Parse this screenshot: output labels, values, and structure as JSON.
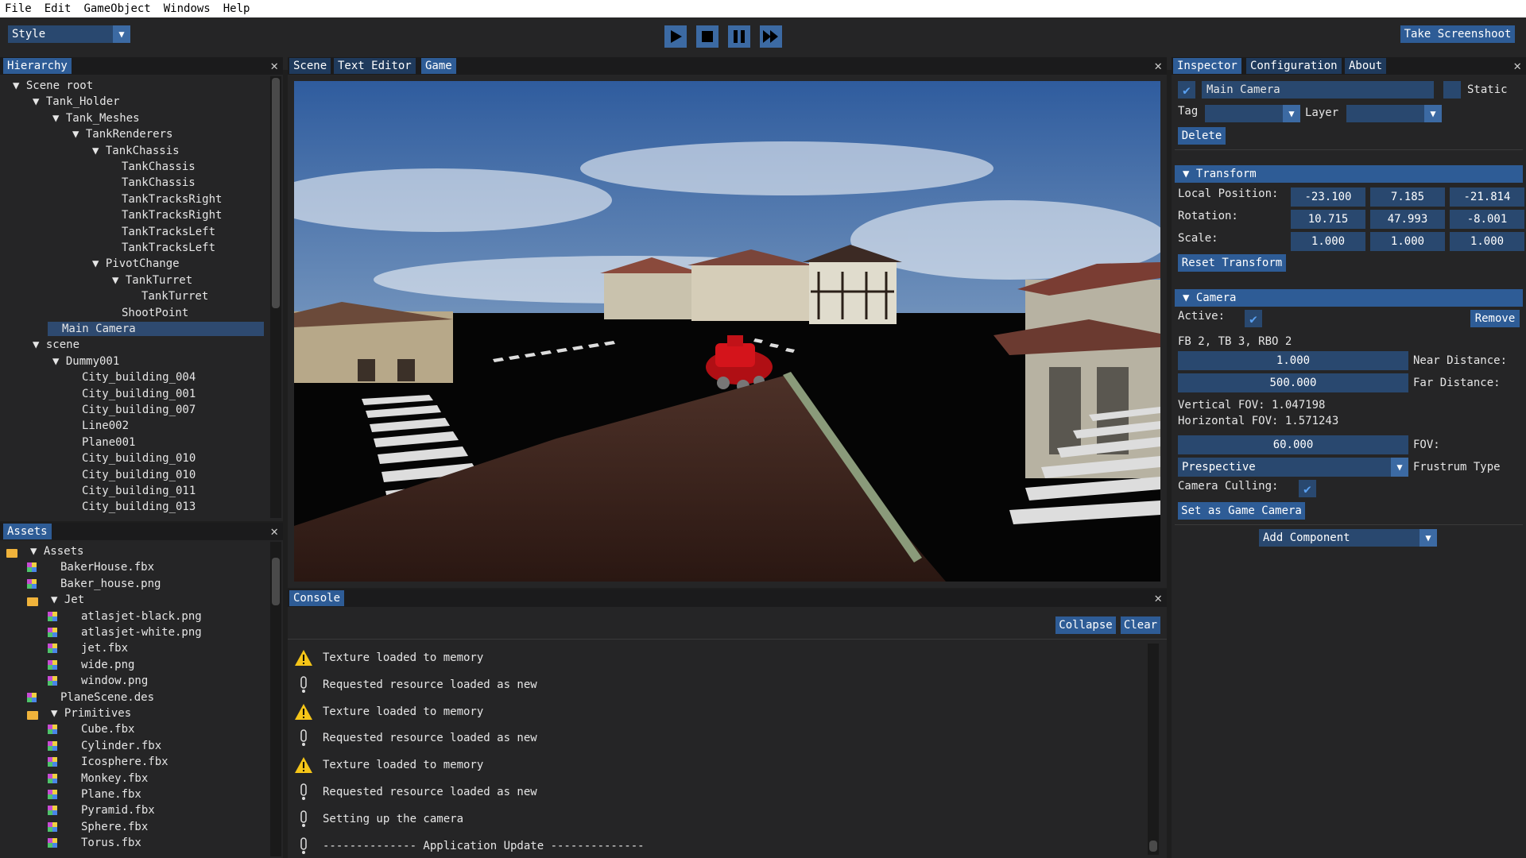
{
  "menu": [
    "File",
    "Edit",
    "GameObject",
    "Windows",
    "Help"
  ],
  "toolbar": {
    "style_label": "Style",
    "screenshot_label": "Take Screenshoot"
  },
  "hierarchy": {
    "tab": "Hierarchy",
    "items": [
      {
        "label": "▼ Scene root",
        "depth": 0
      },
      {
        "label": "▼ Tank_Holder",
        "depth": 1
      },
      {
        "label": "▼ Tank_Meshes",
        "depth": 2
      },
      {
        "label": "▼ TankRenderers",
        "depth": 3
      },
      {
        "label": "▼ TankChassis",
        "depth": 4
      },
      {
        "label": "TankChassis",
        "depth": 5
      },
      {
        "label": "TankChassis",
        "depth": 5
      },
      {
        "label": "TankTracksRight",
        "depth": 5
      },
      {
        "label": "TankTracksRight",
        "depth": 5
      },
      {
        "label": "TankTracksLeft",
        "depth": 5
      },
      {
        "label": "TankTracksLeft",
        "depth": 5
      },
      {
        "label": "▼ PivotChange",
        "depth": 4
      },
      {
        "label": "▼ TankTurret",
        "depth": 5
      },
      {
        "label": "TankTurret",
        "depth": 6
      },
      {
        "label": "ShootPoint",
        "depth": 5
      },
      {
        "label": "Main Camera",
        "depth": 2,
        "selected": true
      },
      {
        "label": "▼ scene",
        "depth": 1
      },
      {
        "label": "▼ Dummy001",
        "depth": 2
      },
      {
        "label": "City_building_004",
        "depth": 3
      },
      {
        "label": "City_building_001",
        "depth": 3
      },
      {
        "label": "City_building_007",
        "depth": 3
      },
      {
        "label": "Line002",
        "depth": 3
      },
      {
        "label": "Plane001",
        "depth": 3
      },
      {
        "label": "City_building_010",
        "depth": 3
      },
      {
        "label": "City_building_010",
        "depth": 3
      },
      {
        "label": "City_building_011",
        "depth": 3
      },
      {
        "label": "City_building_013",
        "depth": 3
      }
    ]
  },
  "assets": {
    "tab": "Assets",
    "items": [
      {
        "label": "▼ Assets",
        "type": "folder",
        "depth": 0
      },
      {
        "label": "BakerHouse.fbx",
        "type": "file",
        "depth": 1
      },
      {
        "label": "Baker_house.png",
        "type": "file",
        "depth": 1
      },
      {
        "label": "▼ Jet",
        "type": "folder",
        "depth": 1
      },
      {
        "label": "atlasjet-black.png",
        "type": "file",
        "depth": 2
      },
      {
        "label": "atlasjet-white.png",
        "type": "file",
        "depth": 2
      },
      {
        "label": "jet.fbx",
        "type": "file",
        "depth": 2
      },
      {
        "label": "wide.png",
        "type": "file",
        "depth": 2
      },
      {
        "label": "window.png",
        "type": "file",
        "depth": 2
      },
      {
        "label": "PlaneScene.des",
        "type": "file",
        "depth": 1
      },
      {
        "label": "▼ Primitives",
        "type": "folder",
        "depth": 1
      },
      {
        "label": "Cube.fbx",
        "type": "file",
        "depth": 2
      },
      {
        "label": "Cylinder.fbx",
        "type": "file",
        "depth": 2
      },
      {
        "label": "Icosphere.fbx",
        "type": "file",
        "depth": 2
      },
      {
        "label": "Monkey.fbx",
        "type": "file",
        "depth": 2
      },
      {
        "label": "Plane.fbx",
        "type": "file",
        "depth": 2
      },
      {
        "label": "Pyramid.fbx",
        "type": "file",
        "depth": 2
      },
      {
        "label": "Sphere.fbx",
        "type": "file",
        "depth": 2
      },
      {
        "label": "Torus.fbx",
        "type": "file",
        "depth": 2
      }
    ]
  },
  "viewport": {
    "tabs": [
      "Scene",
      "Text Editor",
      "Game"
    ]
  },
  "console": {
    "tab": "Console",
    "collapse_label": "Collapse",
    "clear_label": "Clear",
    "entries": [
      {
        "type": "warning",
        "text": "Texture loaded to memory"
      },
      {
        "type": "info",
        "text": "Requested resource loaded as new"
      },
      {
        "type": "warning",
        "text": "Texture loaded to memory"
      },
      {
        "type": "info",
        "text": "Requested resource loaded as new"
      },
      {
        "type": "warning",
        "text": "Texture loaded to memory"
      },
      {
        "type": "info",
        "text": "Requested resource loaded as new"
      },
      {
        "type": "info",
        "text": "Setting up the camera"
      },
      {
        "type": "info",
        "text": "-------------- Application Update --------------"
      }
    ]
  },
  "inspector": {
    "tabs": [
      "Inspector",
      "Configuration",
      "About"
    ],
    "name_value": "Main Camera",
    "static_label": "Static",
    "tag_label": "Tag",
    "layer_label": "Layer",
    "delete_label": "Delete",
    "transform": {
      "header": "Transform",
      "local_position_label": "Local Position:",
      "rotation_label": "Rotation:",
      "scale_label": "Scale:",
      "position": [
        "-23.100",
        "7.185",
        "-21.814"
      ],
      "rotation": [
        "10.715",
        "47.993",
        "-8.001"
      ],
      "scale": [
        "1.000",
        "1.000",
        "1.000"
      ],
      "reset_label": "Reset Transform"
    },
    "camera": {
      "header": "Camera",
      "active_label": "Active:",
      "remove_label": "Remove",
      "buffers_text": "FB 2, TB 3, RBO 2",
      "near_value": "1.000",
      "near_label": "Near Distance:",
      "far_value": "500.000",
      "far_label": "Far Distance:",
      "vfov_text": "Vertical FOV: 1.047198",
      "hfov_text": "Horizontal FOV: 1.571243",
      "fov_value": "60.000",
      "fov_label": "FOV:",
      "frustum_value": "Prespective",
      "frustum_label": "Frustrum Type",
      "culling_label": "Camera Culling:",
      "set_game_camera_label": "Set as Game Camera"
    },
    "add_component_label": "Add Component"
  },
  "colors": {
    "accent": "#2e5c96",
    "field": "#29486f",
    "panel": "#252526",
    "warning": "#f5c518"
  }
}
